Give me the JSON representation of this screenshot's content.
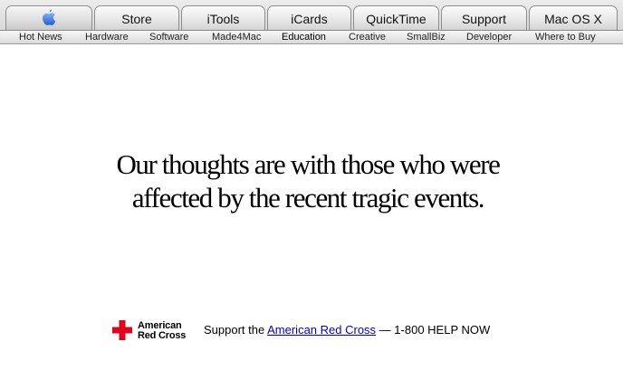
{
  "nav": {
    "apple_icon": "apple-logo",
    "tabs": [
      {
        "label": "Store"
      },
      {
        "label": "iTools"
      },
      {
        "label": "iCards"
      },
      {
        "label": "QuickTime"
      },
      {
        "label": "Support"
      },
      {
        "label": "Mac OS X"
      }
    ],
    "sublinks": [
      {
        "label": "Hot News"
      },
      {
        "label": "Hardware"
      },
      {
        "label": "Software"
      },
      {
        "label": "Made4Mac"
      },
      {
        "label": "Education"
      },
      {
        "label": "Creative"
      },
      {
        "label": "SmallBiz"
      },
      {
        "label": "Developer"
      },
      {
        "label": "Where to Buy"
      }
    ],
    "active_sublink": "Education"
  },
  "message": {
    "line1": "Our thoughts are with those who were",
    "line2": "affected by the recent tragic events."
  },
  "red_cross": {
    "logo_line1": "American",
    "logo_line2": "Red Cross",
    "support_prefix": "Support the",
    "link_text": "American Red Cross",
    "support_suffix": "— 1-800 HELP NOW",
    "cross_color": "#e2001a"
  },
  "colors": {
    "link": "#0000cc",
    "tab_border": "#8d8d8d"
  }
}
